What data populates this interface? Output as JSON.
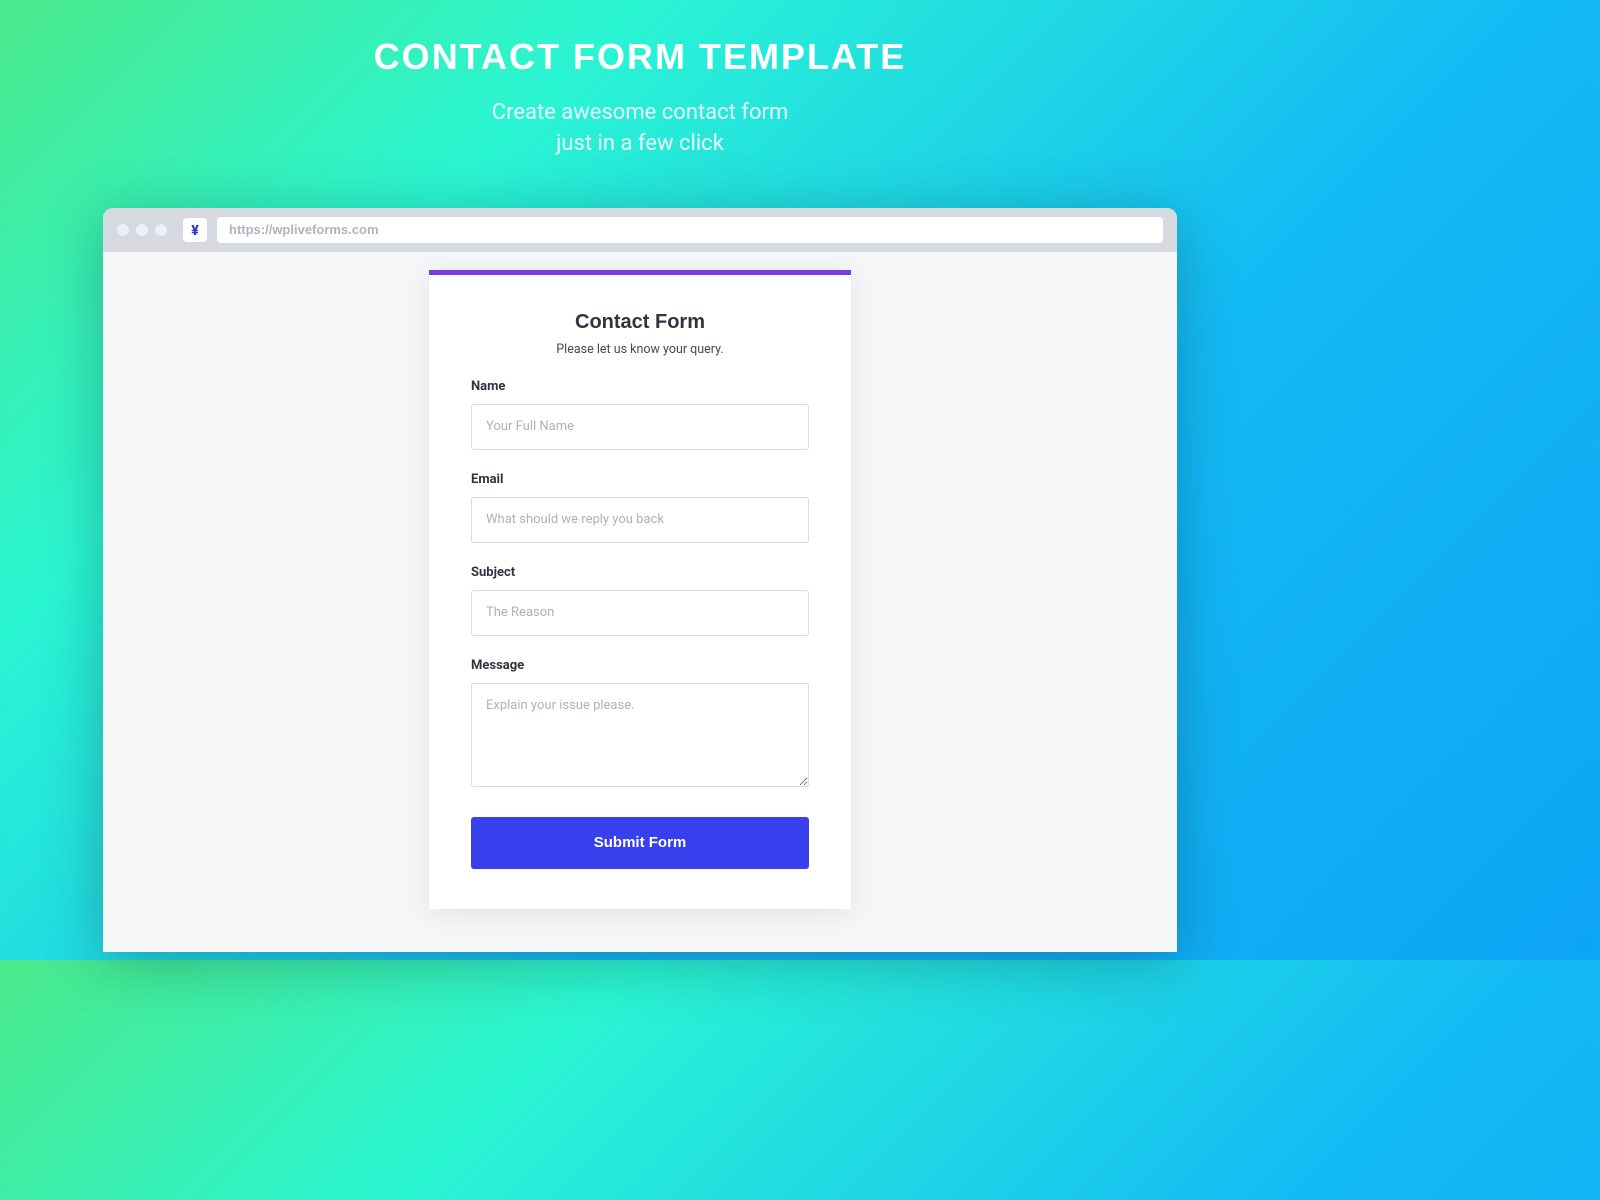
{
  "hero": {
    "title": "CONTACT FORM TEMPLATE",
    "subtitle_line1": "Create awesome contact form",
    "subtitle_line2": "just in a few click"
  },
  "browser": {
    "url": "https://wpliveforms.com"
  },
  "form": {
    "title": "Contact Form",
    "subtitle": "Please let us know your query.",
    "fields": {
      "name": {
        "label": "Name",
        "placeholder": "Your Full Name"
      },
      "email": {
        "label": "Email",
        "placeholder": "What should we reply you back"
      },
      "subject": {
        "label": "Subject",
        "placeholder": "The Reason"
      },
      "message": {
        "label": "Message",
        "placeholder": "Explain your issue please."
      }
    },
    "submit_label": "Submit Form"
  }
}
